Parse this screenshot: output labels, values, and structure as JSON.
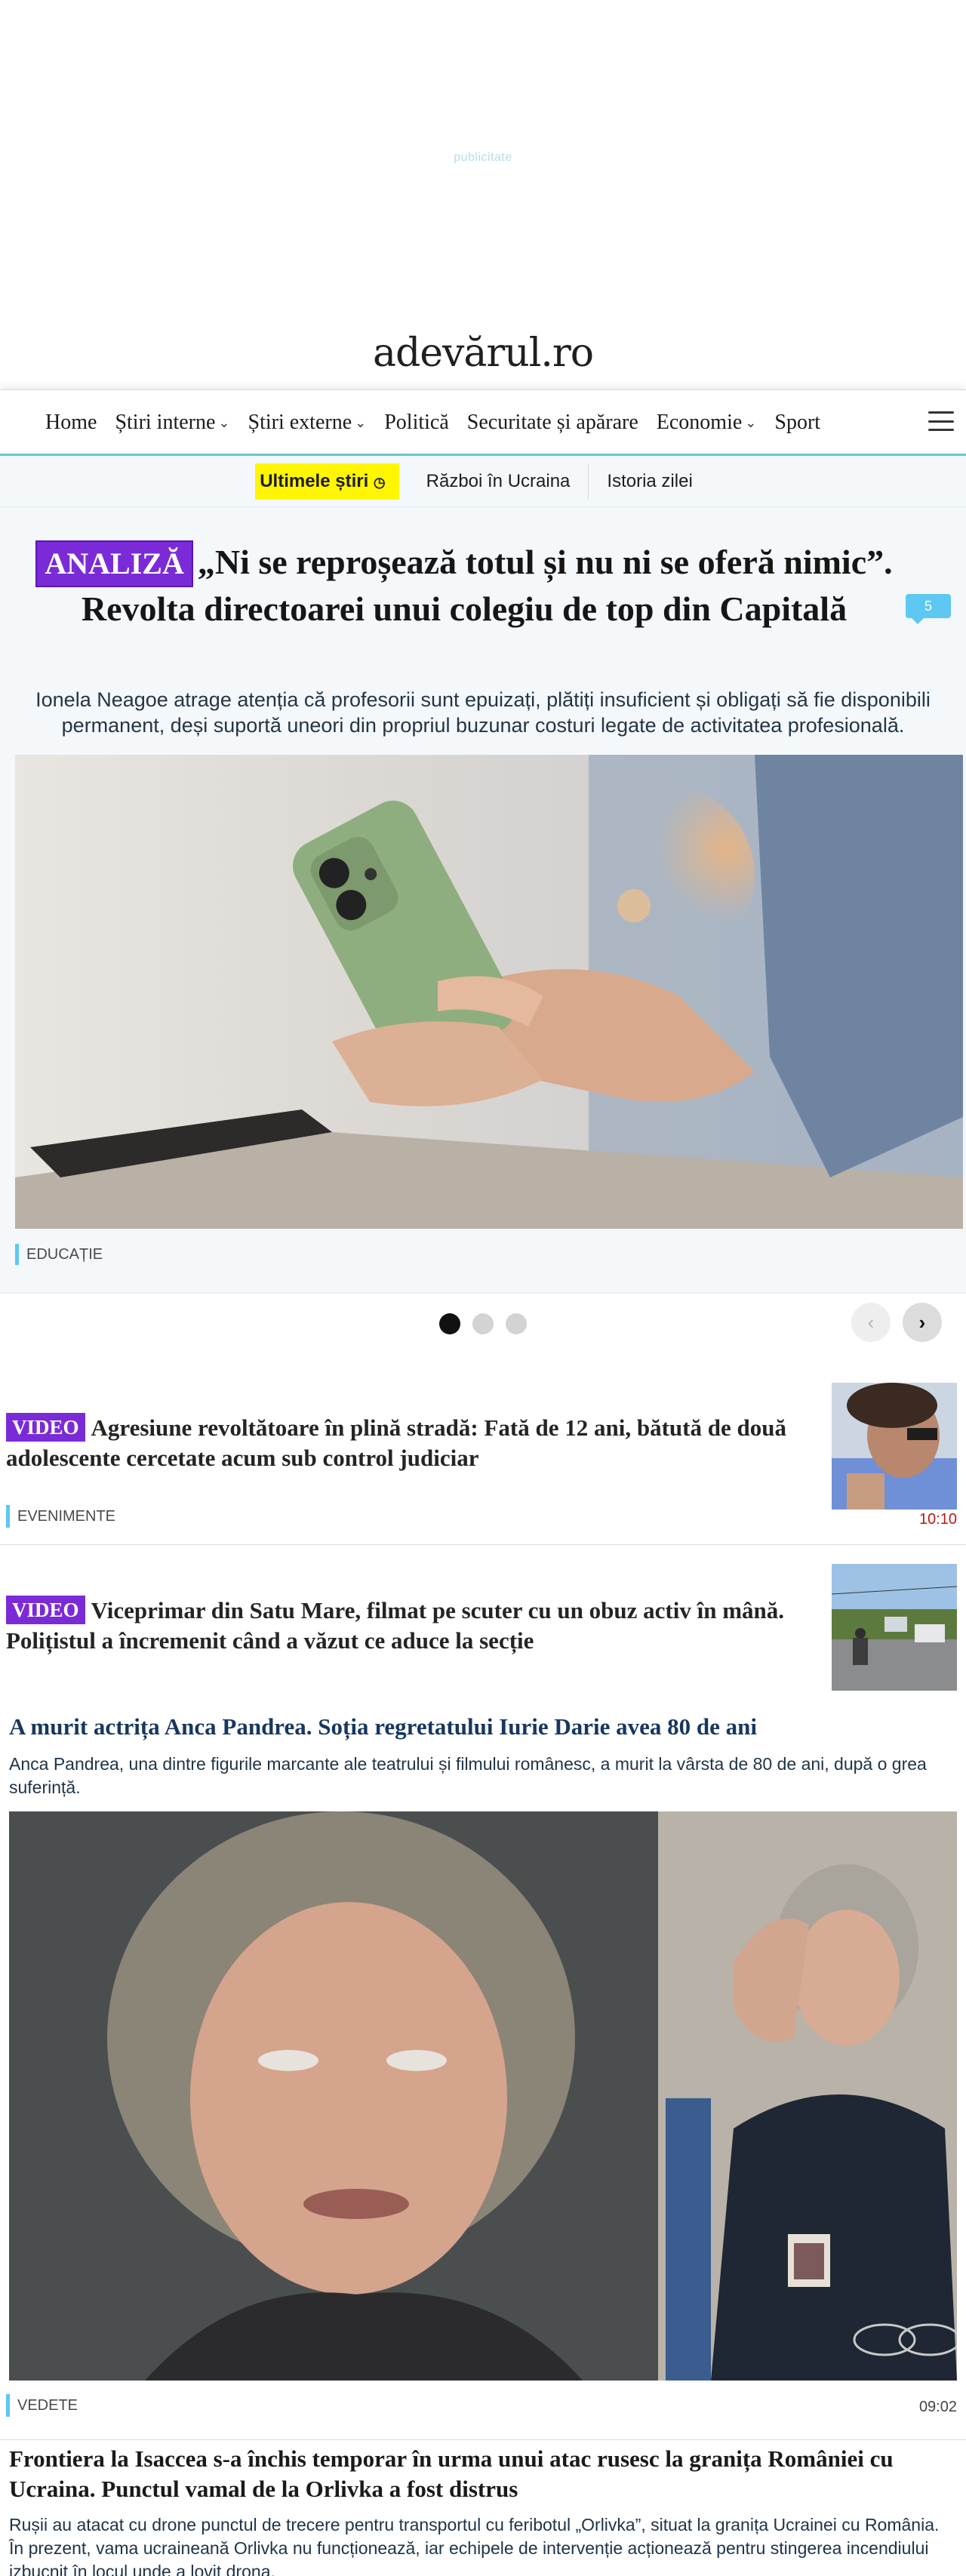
{
  "ad": {
    "label": "publicitate"
  },
  "logo": {
    "text": "adevărul.ro"
  },
  "nav": {
    "items": [
      {
        "label": "Home",
        "has_dropdown": false
      },
      {
        "label": "Știri interne",
        "has_dropdown": true
      },
      {
        "label": "Știri externe",
        "has_dropdown": true
      },
      {
        "label": "Politică",
        "has_dropdown": false
      },
      {
        "label": "Securitate și apărare",
        "has_dropdown": false
      },
      {
        "label": "Economie",
        "has_dropdown": true
      },
      {
        "label": "Sport",
        "has_dropdown": false
      }
    ],
    "chevron": "⌄",
    "menu_icon": "hamburger-icon"
  },
  "subnav": {
    "latest": "Ultimele știri",
    "items": [
      "Război în Ucraina",
      "Istoria zilei"
    ]
  },
  "hero": {
    "tag": "ANALIZĂ",
    "title": "„Ni se reproșează totul și nu ni se oferă nimic”. Revolta directoarei unui colegiu de top din Capitală",
    "comments": "5",
    "lead": "Ionela Neagoe atrage atenția că profesorii sunt epuizați, plătiți insuficient și obligați să fie disponibili permanent, deși suportă uneori din propriul buzunar costuri legate de activitatea profesională.",
    "category": "EDUCAȚIE"
  },
  "carousel": {
    "dots": 3,
    "active_index": 0,
    "prev": "‹",
    "next": "›"
  },
  "articles": [
    {
      "tag": "VIDEO",
      "title": "Agresiune revoltătoare în plină stradă: Fată de 12 ani, bătută de două adolescente cercetate acum sub control judiciar",
      "category": "EVENIMENTE",
      "time": "10:10"
    },
    {
      "tag": "VIDEO",
      "title": "Viceprimar din Satu Mare, filmat pe scuter cu un obuz activ în mână. Polițistul a încremenit când a văzut ce aduce la secție"
    }
  ],
  "featured": {
    "title": "A murit actrița Anca Pandrea. Soția regretatului Iurie Darie avea 80 de ani",
    "lead": "Anca Pandrea, una dintre figurile marcante ale teatrului și filmului românesc, a murit la vârsta de 80 de ani, după o grea suferință.",
    "category": "VEDETE",
    "time": "09:02"
  },
  "next_article": {
    "title": "Frontiera la Isaccea s-a închis temporar în urma unui atac rusesc la granița României cu Ucraina. Punctul vamal de la Orlivka a fost distrus",
    "lead": "Rușii au atacat cu drone punctul de trecere pentru transportul cu feribotul „Orlivka”, situat la granița Ucrainei cu România. În prezent, vama ucraineană Orlivka nu funcționează, iar echipele de intervenție acționează pentru stingerea incendiului izbucnit în locul unde a lovit drona."
  },
  "colors": {
    "accent_teal": "#66c7cb",
    "tag_purple": "#7b2ad8",
    "latest_yellow": "#fff600",
    "comment_blue": "#5ec7f2",
    "title_blue": "#16375f",
    "time_red": "#b81818"
  }
}
